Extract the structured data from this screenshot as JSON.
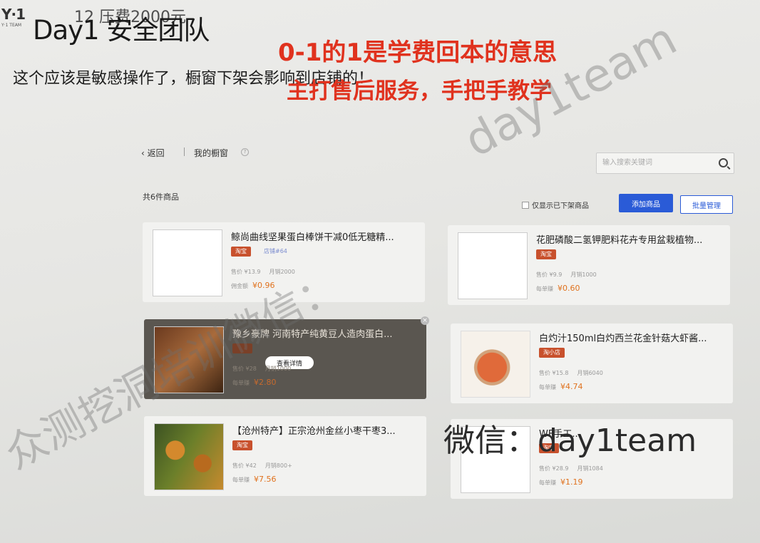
{
  "header": {
    "logo_text": "Y·1",
    "logo_sub": "Y·1 TEAM",
    "team_title": "Day1 安全团队",
    "price_note": "12     压费2000元",
    "description": "这个应该是敏感操作了，橱窗下架会影响到店铺的！",
    "promo_line1": "0-1的1是学费回本的意思",
    "promo_line2": "主打售后服务，手把手教学"
  },
  "watermarks": {
    "english": "day1team",
    "chinese": "众测挖洞培训微信：",
    "wechat": "微信：day1team"
  },
  "page": {
    "back_label": "返回",
    "breadcrumb": "我的橱窗",
    "search_placeholder": "输入搜索关键词",
    "product_count": "共6件商品",
    "filter_label": "仅显示已下架商品",
    "add_button": "添加商品",
    "batch_button": "批量管理",
    "detail_button": "查看详情",
    "products": [
      {
        "title": "鲸尚曲线坚果蛋白棒饼干减0低无糖精...",
        "tag": "淘宝",
        "tag2": "店铺#64",
        "price": "售价 ¥13.9",
        "sales": "月销2000",
        "profit_label": "佣金额",
        "profit": "¥0.96"
      },
      {
        "title": "花肥磷酸二氢钾肥料花卉专用盆栽植物...",
        "tag": "淘宝",
        "tag2": "",
        "price": "售价 ¥9.9",
        "sales": "月销1000",
        "profit_label": "每单赚",
        "profit": "¥0.60"
      },
      {
        "title": "豫乡豪牌 河南特产纯黄豆人造肉蛋白...",
        "tag": "淘宝",
        "tag2": "",
        "price": "售价 ¥28",
        "sales": "月销1000",
        "profit_label": "每单赚",
        "profit": "¥2.80"
      },
      {
        "title": "白灼汁150ml白灼西兰花金针菇大虾酱...",
        "tag": "淘小店",
        "tag2": "",
        "price": "售价 ¥15.8",
        "sales": "月销6040",
        "profit_label": "每单赚",
        "profit": "¥4.74"
      },
      {
        "title": "【沧州特产】正宗沧州金丝小枣干枣3...",
        "tag": "淘宝",
        "tag2": "",
        "price": "售价 ¥42",
        "sales": "月销800+",
        "profit_label": "每单赚",
        "profit": "¥7.56"
      },
      {
        "title": "WF手工...",
        "tag": "淘宝",
        "tag2": "",
        "price": "售价 ¥28.9",
        "sales": "月销1084",
        "profit_label": "每单赚",
        "profit": "¥1.19"
      }
    ]
  }
}
